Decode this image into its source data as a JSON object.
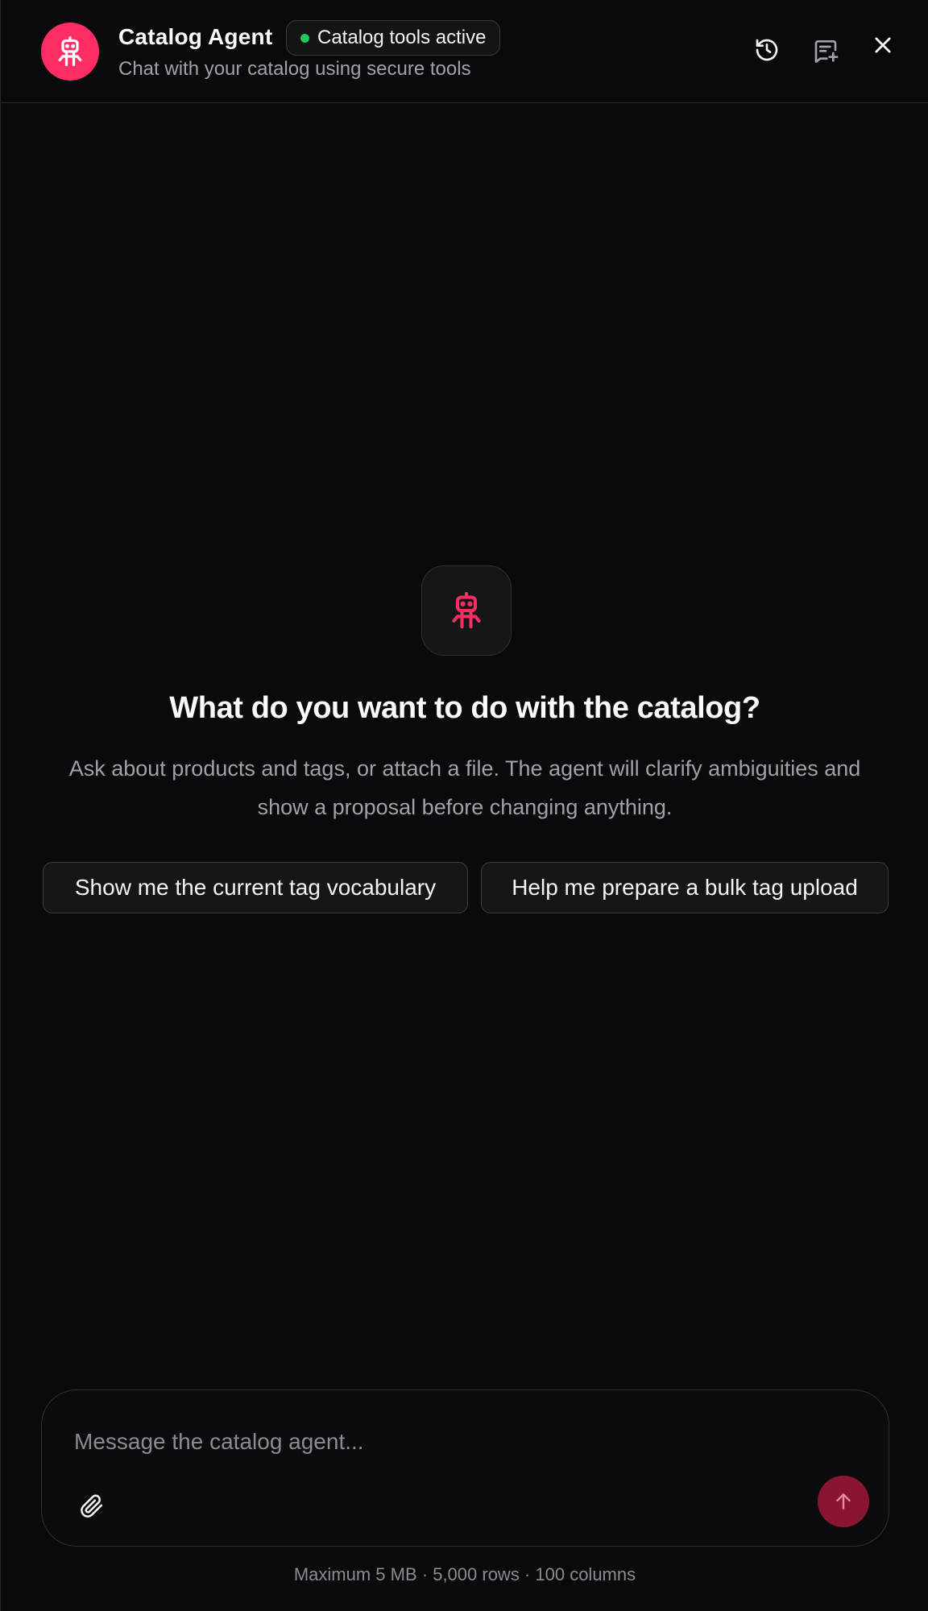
{
  "header": {
    "title": "Catalog Agent",
    "status_badge": "Catalog tools active",
    "subtitle": "Chat with your catalog using secure tools",
    "icons": [
      "robot-icon",
      "history-icon",
      "new-chat-icon",
      "close-icon"
    ]
  },
  "empty_state": {
    "heading": "What do you want to do with the catalog?",
    "description": "Ask about products and tags, or attach a file. The agent will clarify ambiguities and show a proposal before changing anything.",
    "suggestions": [
      "Show me the current tag vocabulary",
      "Help me prepare a bulk tag upload"
    ]
  },
  "composer": {
    "placeholder": "Message the catalog agent...",
    "value": "",
    "limits": "Maximum 5 MB · 5,000 rows · 100 columns"
  },
  "colors": {
    "accent": "#ff2d63",
    "send_disabled": "#8a1530",
    "status_dot": "#22c55e",
    "background": "#0a0a0c"
  }
}
